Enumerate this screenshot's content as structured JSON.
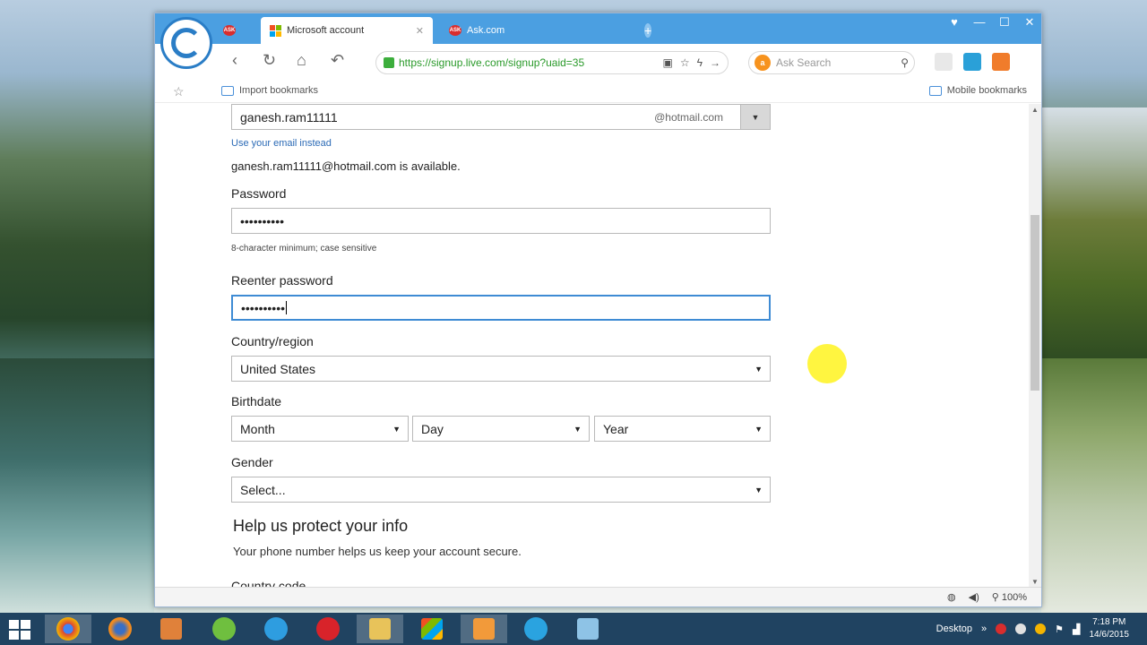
{
  "browser": {
    "tabs": [
      {
        "label": "Microsoft account",
        "active": true
      },
      {
        "label": "Ask.com",
        "active": false
      }
    ],
    "url": "https://signup.live.com/signup?uaid=35",
    "search_placeholder": "Ask Search",
    "bookmarks": {
      "import_label": "Import bookmarks",
      "mobile_label": "Mobile bookmarks"
    },
    "status": {
      "zoom": "100%"
    }
  },
  "form": {
    "username_value": "ganesh.ram11111",
    "username_domain": "@hotmail.com",
    "use_email_link": "Use your email instead",
    "availability_text": "ganesh.ram11111@hotmail.com is available.",
    "password_label": "Password",
    "password_value": "••••••••••",
    "password_hint": "8-character minimum; case sensitive",
    "reenter_label": "Reenter password",
    "reenter_value": "••••••••••",
    "country_label": "Country/region",
    "country_value": "United States",
    "birthdate_label": "Birthdate",
    "month_value": "Month",
    "day_value": "Day",
    "year_value": "Year",
    "gender_label": "Gender",
    "gender_value": "Select...",
    "protect_heading": "Help us protect your info",
    "protect_text": "Your phone number helps us keep your account secure.",
    "country_code_label": "Country code"
  },
  "taskbar": {
    "desktop_label": "Desktop",
    "time": "7:18 PM",
    "date": "14/6/2015"
  },
  "colors": {
    "titlebar": "#4b9fe1",
    "link": "#2c6bb6",
    "focus": "#3e8bd4",
    "highlight": "#fff200"
  }
}
